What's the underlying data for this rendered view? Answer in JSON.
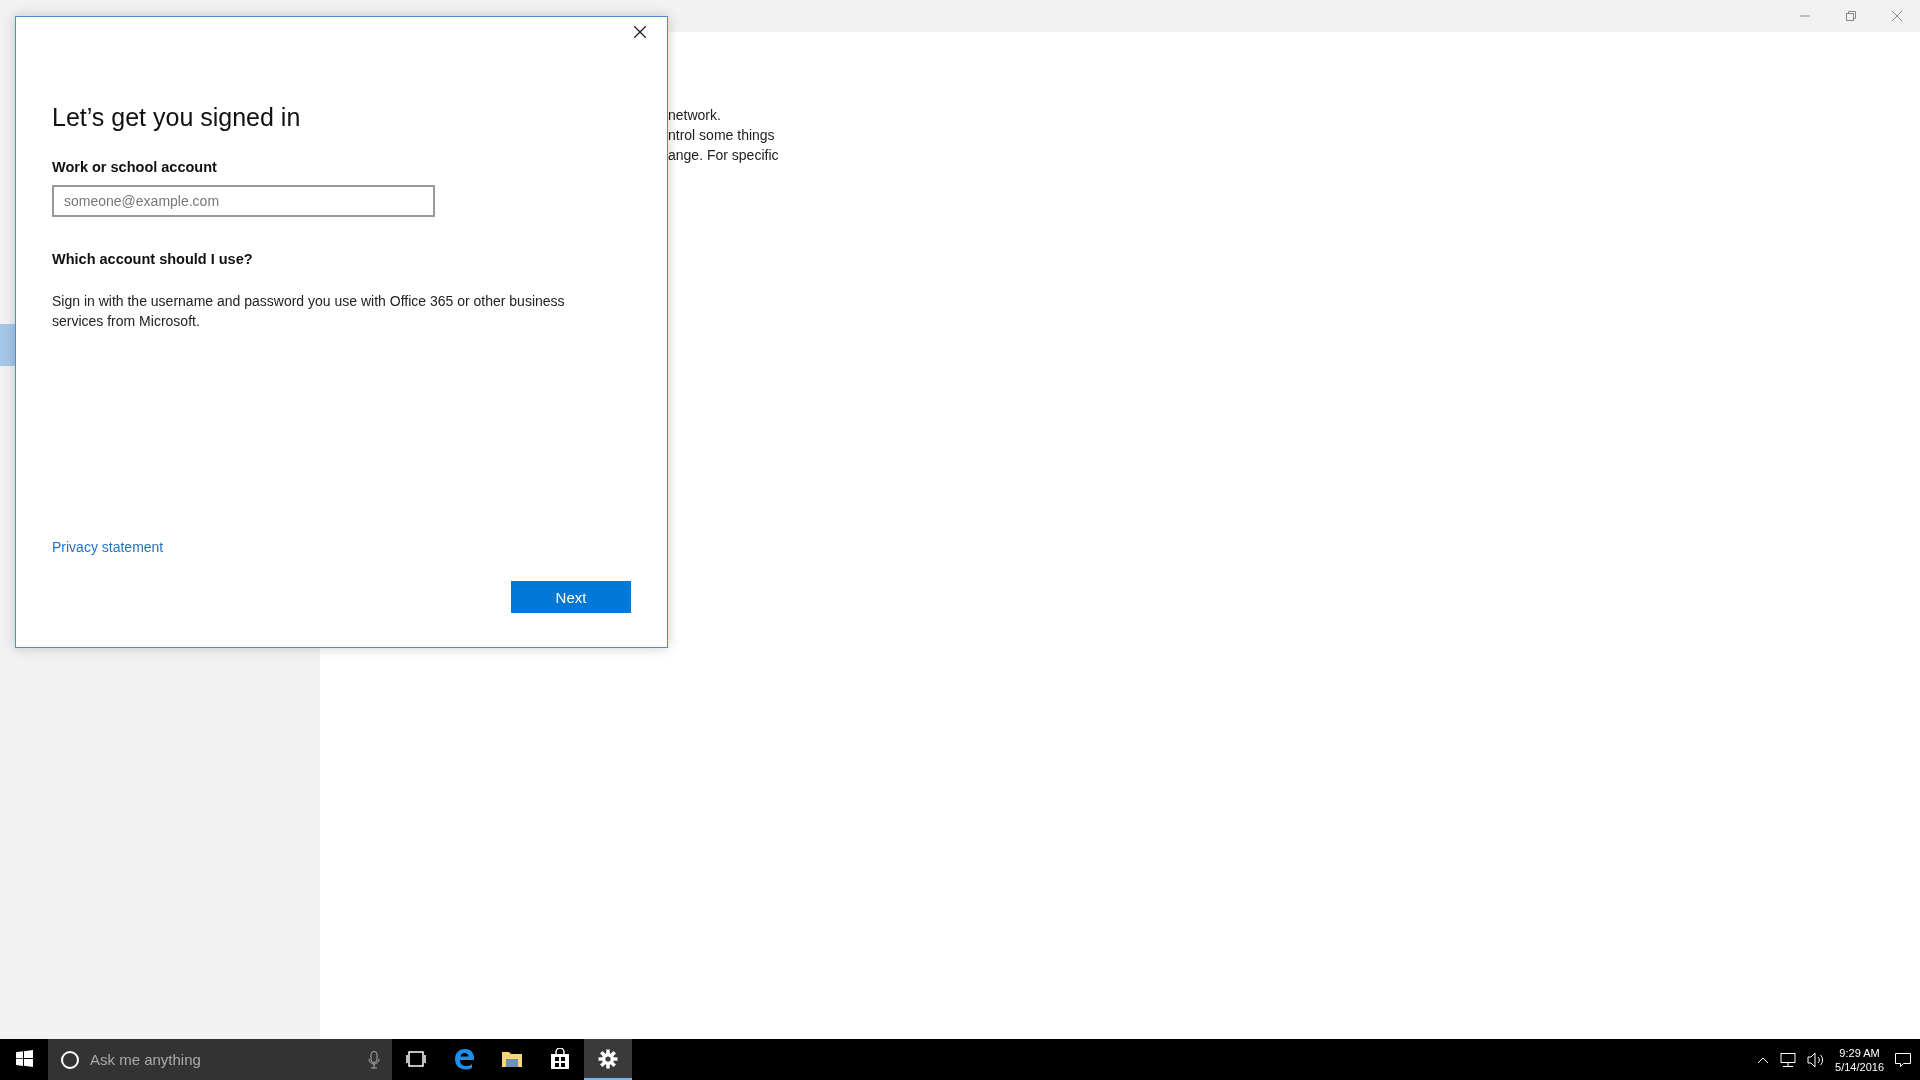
{
  "background_text": [
    "network.",
    "ntrol some things",
    "ange. For specific"
  ],
  "dialog": {
    "title": "Let’s get you signed in",
    "field_label": "Work or school account",
    "field": {
      "placeholder": "someone@example.com"
    },
    "help_heading": "Which account should I use?",
    "help_text": "Sign in with the username and password you use with Office 365 or other business services from Microsoft.",
    "link": "Privacy statement",
    "button": "Next"
  },
  "taskbar": {
    "search": {
      "placeholder": "Ask me anything"
    },
    "apps": [
      {
        "kind": "taskview",
        "selected": false
      },
      {
        "kind": "browser",
        "selected": false
      },
      {
        "kind": "explorer",
        "selected": false
      },
      {
        "kind": "store",
        "selected": false
      },
      {
        "kind": "settings",
        "selected": true
      }
    ],
    "time": "9:29 AM",
    "date": "5/14/2016"
  }
}
